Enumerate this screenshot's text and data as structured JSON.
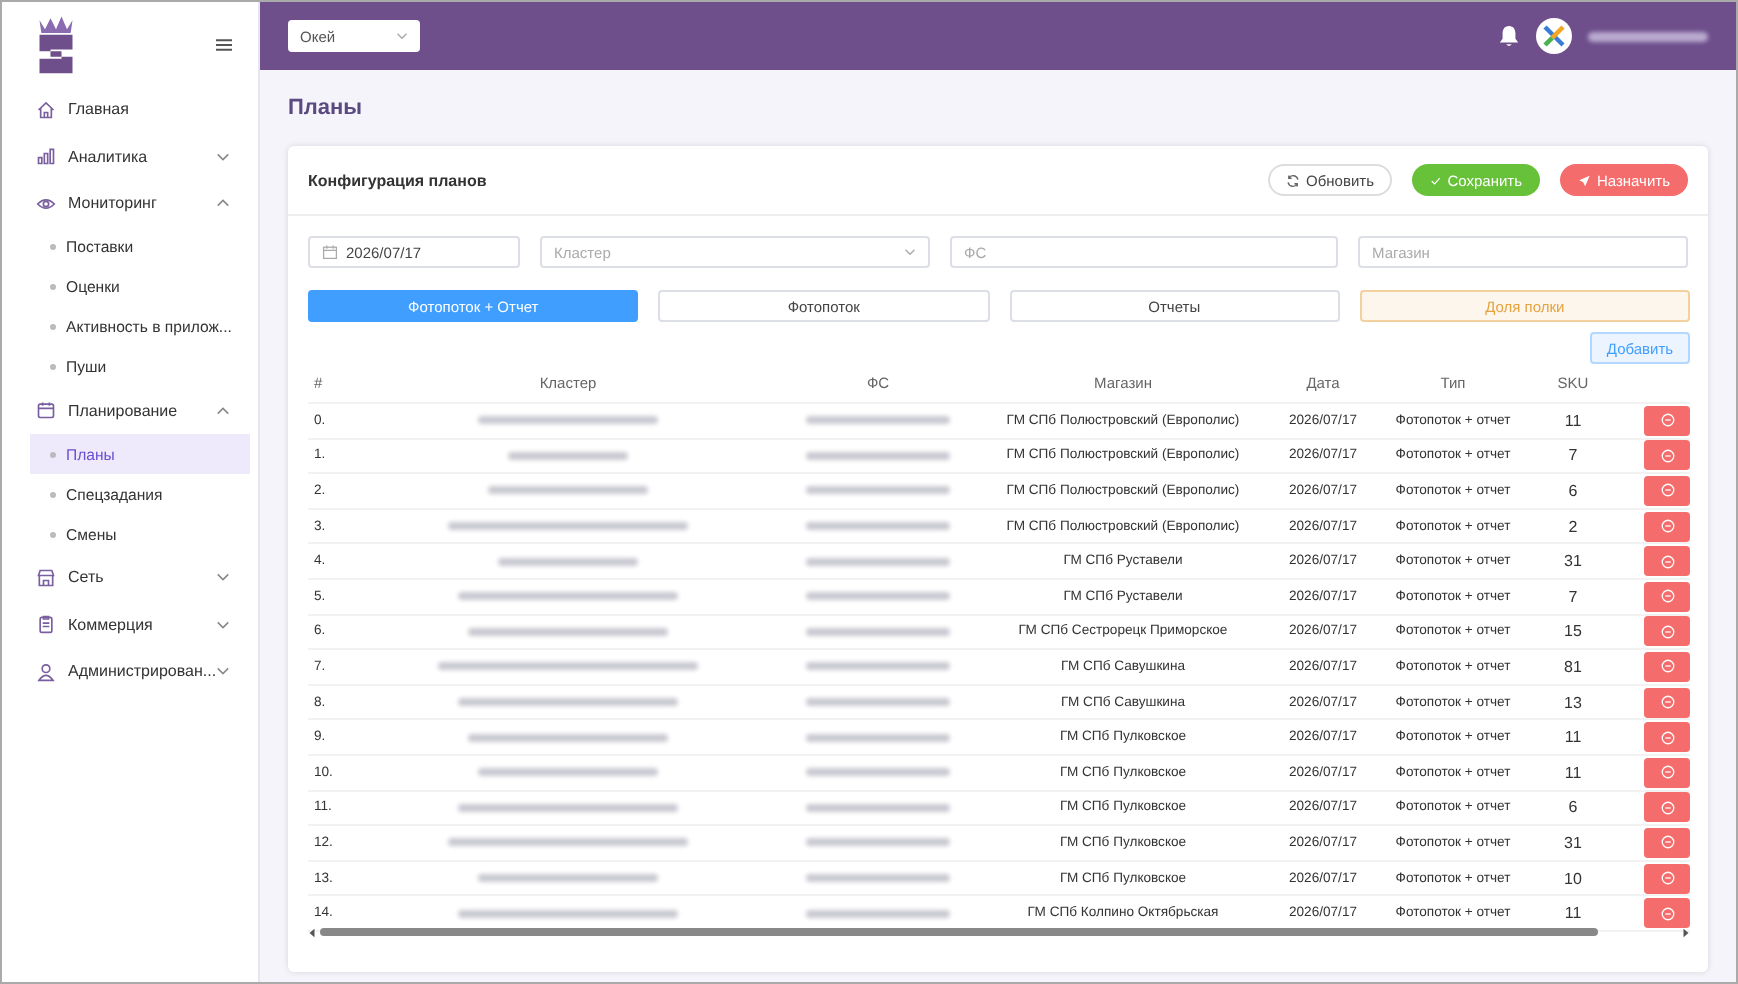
{
  "sidebar": {
    "items": [
      {
        "label": "Главная",
        "kind": "link",
        "selected": false
      },
      {
        "label": "Аналитика",
        "kind": "group",
        "expanded": false,
        "selected": false
      },
      {
        "label": "Мониторинг",
        "kind": "group",
        "expanded": true,
        "selected": false,
        "children": [
          {
            "label": "Поставки",
            "selected": false
          },
          {
            "label": "Оценки",
            "selected": false
          },
          {
            "label": "Активность в прилож...",
            "selected": false
          },
          {
            "label": "Пуши",
            "selected": false
          }
        ]
      },
      {
        "label": "Планирование",
        "kind": "group",
        "expanded": true,
        "selected": false,
        "children": [
          {
            "label": "Планы",
            "selected": true
          },
          {
            "label": "Спецзадания",
            "selected": false
          },
          {
            "label": "Смены",
            "selected": false
          }
        ]
      },
      {
        "label": "Сеть",
        "kind": "group",
        "expanded": false,
        "selected": false
      },
      {
        "label": "Коммерция",
        "kind": "group",
        "expanded": false,
        "selected": false
      },
      {
        "label": "Администрирован...",
        "kind": "group",
        "expanded": false,
        "selected": false
      }
    ]
  },
  "header": {
    "store_select": {
      "value": "Окей"
    }
  },
  "page": {
    "title": "Планы"
  },
  "card": {
    "title": "Конфигурация планов",
    "buttons": [
      {
        "label": "Обновить",
        "kind": "refresh"
      },
      {
        "label": "Сохранить",
        "kind": "save"
      },
      {
        "label": "Назначить",
        "kind": "assign"
      }
    ],
    "filters": {
      "date": "2026/07/17",
      "cluster_placeholder": "Кластер",
      "fs_placeholder": "ФС",
      "store_placeholder": "Магазин"
    },
    "tabs": [
      {
        "label": "Фотопоток + Отчет",
        "selected": true,
        "kind": "default"
      },
      {
        "label": "Фотопоток",
        "selected": false,
        "kind": "default"
      },
      {
        "label": "Отчеты",
        "selected": false,
        "kind": "default"
      },
      {
        "label": "Доля полки",
        "selected": false,
        "kind": "warning"
      }
    ],
    "add_button": "Добавить"
  },
  "table": {
    "columns": [
      "#",
      "Кластер",
      "ФС",
      "Магазин",
      "Дата",
      "Тип",
      "SKU"
    ],
    "rows": [
      {
        "index": "0.",
        "store": "ГМ СПб Полюстровский (Европолис)",
        "date": "2026/07/17",
        "type": "Фотопоток + отчет",
        "sku": "11"
      },
      {
        "index": "1.",
        "store": "ГМ СПб Полюстровский (Европолис)",
        "date": "2026/07/17",
        "type": "Фотопоток + отчет",
        "sku": "7"
      },
      {
        "index": "2.",
        "store": "ГМ СПб Полюстровский (Европолис)",
        "date": "2026/07/17",
        "type": "Фотопоток + отчет",
        "sku": "6"
      },
      {
        "index": "3.",
        "store": "ГМ СПб Полюстровский (Европолис)",
        "date": "2026/07/17",
        "type": "Фотопоток + отчет",
        "sku": "2"
      },
      {
        "index": "4.",
        "store": "ГМ СПб Руставели",
        "date": "2026/07/17",
        "type": "Фотопоток + отчет",
        "sku": "31"
      },
      {
        "index": "5.",
        "store": "ГМ СПб Руставели",
        "date": "2026/07/17",
        "type": "Фотопоток + отчет",
        "sku": "7"
      },
      {
        "index": "6.",
        "store": "ГМ СПб Сестрорецк Приморское",
        "date": "2026/07/17",
        "type": "Фотопоток + отчет",
        "sku": "15"
      },
      {
        "index": "7.",
        "store": "ГМ СПб Савушкина",
        "date": "2026/07/17",
        "type": "Фотопоток + отчет",
        "sku": "81"
      },
      {
        "index": "8.",
        "store": "ГМ СПб Савушкина",
        "date": "2026/07/17",
        "type": "Фотопоток + отчет",
        "sku": "13"
      },
      {
        "index": "9.",
        "store": "ГМ СПб Пулковское",
        "date": "2026/07/17",
        "type": "Фотопоток + отчет",
        "sku": "11"
      },
      {
        "index": "10.",
        "store": "ГМ СПб Пулковское",
        "date": "2026/07/17",
        "type": "Фотопоток + отчет",
        "sku": "11"
      },
      {
        "index": "11.",
        "store": "ГМ СПб Пулковское",
        "date": "2026/07/17",
        "type": "Фотопоток + отчет",
        "sku": "6"
      },
      {
        "index": "12.",
        "store": "ГМ СПб Пулковское",
        "date": "2026/07/17",
        "type": "Фотопоток + отчет",
        "sku": "31"
      },
      {
        "index": "13.",
        "store": "ГМ СПб Пулковское",
        "date": "2026/07/17",
        "type": "Фотопоток + отчет",
        "sku": "10"
      },
      {
        "index": "14.",
        "store": "ГМ СПб Колпино Октябрьская",
        "date": "2026/07/17",
        "type": "Фотопоток + отчет",
        "sku": "11"
      }
    ]
  }
}
